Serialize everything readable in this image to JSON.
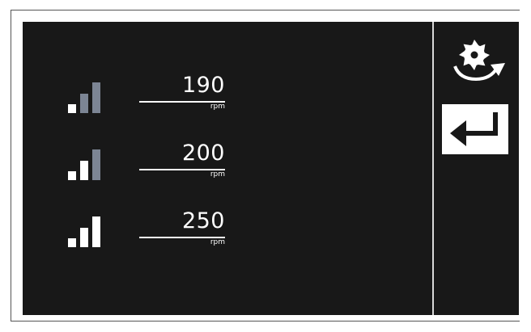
{
  "speeds": [
    {
      "value": "190",
      "unit": "rpm",
      "level": 1,
      "level_max": 3
    },
    {
      "value": "200",
      "unit": "rpm",
      "level": 2,
      "level_max": 3
    },
    {
      "value": "250",
      "unit": "rpm",
      "level": 3,
      "level_max": 3
    }
  ],
  "side_panel": {
    "rotate_icon": "saw-blade-rotate-icon",
    "enter_icon": "enter-return-arrow-icon"
  },
  "colors": {
    "screen_background": "#181818",
    "active_bar": "#ffffff",
    "inactive_bar": "#7c8594",
    "text": "#ffffff"
  }
}
